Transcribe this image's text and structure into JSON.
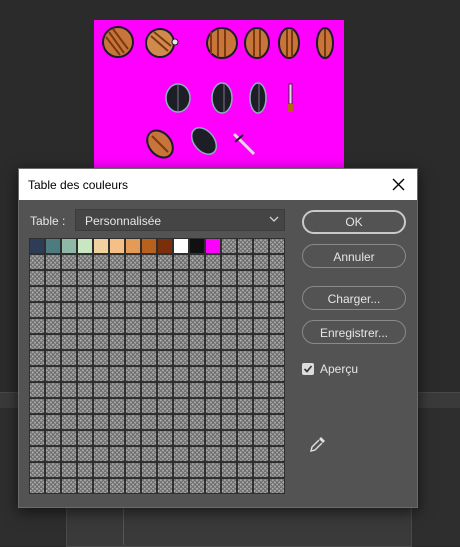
{
  "dialog": {
    "title": "Table des couleurs",
    "table_label": "Table :",
    "table_value": "Personnalisée",
    "buttons": {
      "ok": "OK",
      "cancel": "Annuler",
      "load": "Charger...",
      "save": "Enregistrer..."
    },
    "preview_label": "Aperçu",
    "preview_checked": true
  },
  "palette": [
    "#2e3c57",
    "#4e7b80",
    "#8fb9a6",
    "#c7e6c1",
    "#f0d2a0",
    "#f5bf88",
    "#e39b56",
    "#b8611d",
    "#7a2e0a",
    "#ffffff",
    "#111111",
    "#ff00ff"
  ],
  "grid": {
    "columns": 16,
    "rows": 16
  },
  "colors": {
    "canvas_background": "#ff00ff",
    "dialog_background": "#535353"
  },
  "icons": {
    "close": "close-icon",
    "dropdown": "chevron-down-icon",
    "checkbox": "checkmark-icon",
    "eyedropper": "eyedropper-icon"
  }
}
